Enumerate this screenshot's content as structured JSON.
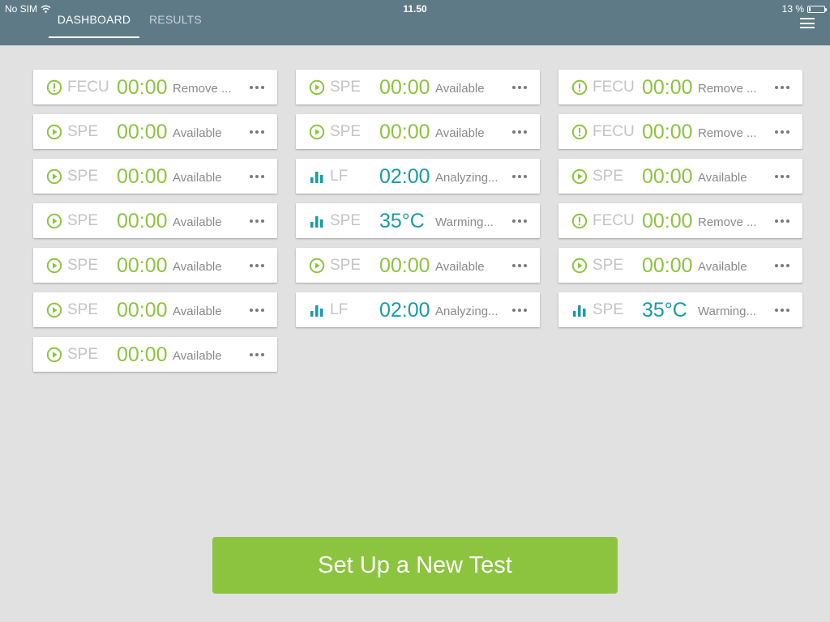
{
  "colors": {
    "header_bg": "#5f7a87",
    "background": "#e1e1e1",
    "accent_green": "#8cc43f",
    "accent_teal": "#1a9aa8",
    "muted_label": "#c4c4c4"
  },
  "status_bar": {
    "carrier": "No SIM",
    "time": "11.50",
    "battery": "13 %",
    "battery_level": 0.13
  },
  "tabs": [
    {
      "label": "DASHBOARD",
      "active": true
    },
    {
      "label": "RESULTS",
      "active": false
    }
  ],
  "menu_icon": "hamburger-menu-icon",
  "columns": [
    [
      {
        "icon": "alert-icon",
        "type": "FECU",
        "time": "00:00",
        "status": "Remove ...",
        "time_color": "#8cc43f",
        "icon_color": "#8cc43f"
      },
      {
        "icon": "play-icon",
        "type": "SPE",
        "time": "00:00",
        "status": "Available",
        "time_color": "#8cc43f",
        "icon_color": "#8cc43f"
      },
      {
        "icon": "play-icon",
        "type": "SPE",
        "time": "00:00",
        "status": "Available",
        "time_color": "#8cc43f",
        "icon_color": "#8cc43f"
      },
      {
        "icon": "play-icon",
        "type": "SPE",
        "time": "00:00",
        "status": "Available",
        "time_color": "#8cc43f",
        "icon_color": "#8cc43f"
      },
      {
        "icon": "play-icon",
        "type": "SPE",
        "time": "00:00",
        "status": "Available",
        "time_color": "#8cc43f",
        "icon_color": "#8cc43f"
      },
      {
        "icon": "play-icon",
        "type": "SPE",
        "time": "00:00",
        "status": "Available",
        "time_color": "#8cc43f",
        "icon_color": "#8cc43f"
      },
      {
        "icon": "play-icon",
        "type": "SPE",
        "time": "00:00",
        "status": "Available",
        "time_color": "#8cc43f",
        "icon_color": "#8cc43f"
      }
    ],
    [
      {
        "icon": "play-icon",
        "type": "SPE",
        "time": "00:00",
        "status": "Available",
        "time_color": "#8cc43f",
        "icon_color": "#8cc43f"
      },
      {
        "icon": "play-icon",
        "type": "SPE",
        "time": "00:00",
        "status": "Available",
        "time_color": "#8cc43f",
        "icon_color": "#8cc43f"
      },
      {
        "icon": "bar-chart-icon",
        "type": "LF",
        "time": "02:00",
        "status": "Analyzing...",
        "time_color": "#1a9aa8",
        "icon_color": "#1a9aa8"
      },
      {
        "icon": "bar-chart-icon",
        "type": "SPE",
        "time": "35°C",
        "status": "Warming...",
        "time_color": "#1a9aa8",
        "icon_color": "#1a9aa8"
      },
      {
        "icon": "play-icon",
        "type": "SPE",
        "time": "00:00",
        "status": "Available",
        "time_color": "#8cc43f",
        "icon_color": "#8cc43f"
      },
      {
        "icon": "bar-chart-icon",
        "type": "LF",
        "time": "02:00",
        "status": "Analyzing...",
        "time_color": "#1a9aa8",
        "icon_color": "#1a9aa8"
      }
    ],
    [
      {
        "icon": "alert-icon",
        "type": "FECU",
        "time": "00:00",
        "status": "Remove ...",
        "time_color": "#8cc43f",
        "icon_color": "#8cc43f"
      },
      {
        "icon": "alert-icon",
        "type": "FECU",
        "time": "00:00",
        "status": "Remove ...",
        "time_color": "#8cc43f",
        "icon_color": "#8cc43f"
      },
      {
        "icon": "play-icon",
        "type": "SPE",
        "time": "00:00",
        "status": "Available",
        "time_color": "#8cc43f",
        "icon_color": "#8cc43f"
      },
      {
        "icon": "alert-icon",
        "type": "FECU",
        "time": "00:00",
        "status": "Remove ...",
        "time_color": "#8cc43f",
        "icon_color": "#8cc43f"
      },
      {
        "icon": "play-icon",
        "type": "SPE",
        "time": "00:00",
        "status": "Available",
        "time_color": "#8cc43f",
        "icon_color": "#8cc43f"
      },
      {
        "icon": "bar-chart-icon",
        "type": "SPE",
        "time": "35°C",
        "status": "Warming...",
        "time_color": "#1a9aa8",
        "icon_color": "#1a9aa8"
      }
    ]
  ],
  "cta": {
    "label": "Set Up a New Test"
  }
}
